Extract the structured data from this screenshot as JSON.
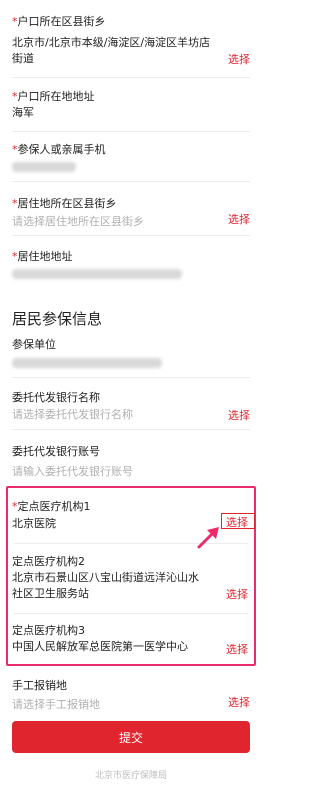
{
  "fields": {
    "hukou_area": {
      "label": "户口所在区县街乡",
      "required": true,
      "value": "北京市/北京市本级/海淀区/海淀区羊坊店街道",
      "action": "选择"
    },
    "hukou_address": {
      "label": "户口所在地地址",
      "required": true,
      "value": "海军"
    },
    "contact_phone": {
      "label": "参保人或亲属手机",
      "required": true
    },
    "residence_area": {
      "label": "居住地所在区县街乡",
      "required": true,
      "placeholder": "请选择居住地所在区县街乡",
      "action": "选择"
    },
    "residence_address": {
      "label": "居住地地址",
      "required": true
    }
  },
  "section": {
    "title": "居民参保信息"
  },
  "insurance": {
    "employer": {
      "label": "参保单位"
    },
    "bank_name": {
      "label": "委托代发银行名称",
      "placeholder": "请选择委托代发银行名称",
      "action": "选择"
    },
    "bank_account": {
      "label": "委托代发银行账号",
      "placeholder": "请输入委托代发银行账号"
    }
  },
  "hospitals": [
    {
      "label": "定点医疗机构1",
      "required": true,
      "value": "北京医院",
      "action": "选择"
    },
    {
      "label": "定点医疗机构2",
      "required": false,
      "value": "北京市石景山区八宝山街道远洋沁山水社区卫生服务站",
      "action": "选择"
    },
    {
      "label": "定点医疗机构3",
      "required": false,
      "value": "中国人民解放军总医院第一医学中心",
      "action": "选择"
    }
  ],
  "reimbursement": {
    "label": "手工报销地",
    "placeholder": "请选择手工报销地",
    "action": "选择"
  },
  "submit_label": "提交",
  "footer": "北京市医疗保障局",
  "colors": {
    "accent": "#e0252e",
    "annotation": "#ee2b6a"
  }
}
